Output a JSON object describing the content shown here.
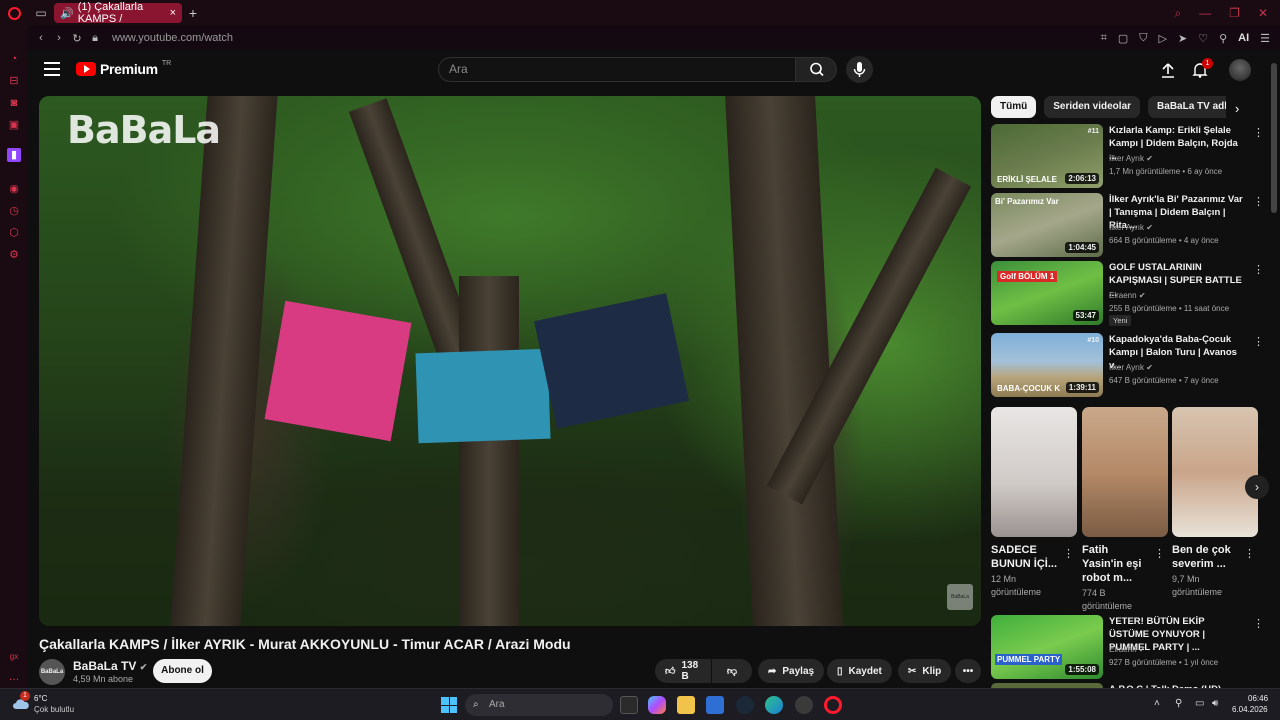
{
  "browser": {
    "tab_title": "(1) Çakallarla KAMPS /",
    "url": "www.youtube.com/watch",
    "ai_label": "AI"
  },
  "youtube": {
    "logo_text": "Premium",
    "country_code": "TR",
    "search_placeholder": "Ara",
    "notification_count": "1"
  },
  "player": {
    "brand_watermark": "BaBaLa",
    "corner_watermark": "BaBaLa"
  },
  "video": {
    "title": "Çakallarla KAMPS / İlker AYRIK - Murat AKKOYUNLU - Timur ACAR / Arazi Modu",
    "channel_name": "BaBaLa TV",
    "channel_avatar_text": "BaBaLa",
    "subscribers": "4,59 Mn abone",
    "subscribe_label": "Abone ol",
    "like_count": "138 B",
    "share_label": "Paylaş",
    "save_label": "Kaydet",
    "clip_label": "Klip"
  },
  "chips": [
    "Tümü",
    "Seriden videolar",
    "BaBaLa TV adlı yükle"
  ],
  "recommendations": [
    {
      "title": "Kızlarla Kamp: Erikli Şelale Kampı | Didem Balçın, Rojda ...",
      "channel": "İlker Ayrık",
      "views": "1,7 Mn görüntüleme",
      "age": "6 ay önce",
      "duration": "2:06:13",
      "thumb_text": "ERİKLİ ŞELALE",
      "episode": "#11"
    },
    {
      "title": "İlker Ayrık'la Bi' Pazarımız Var | Tanışma | Didem Balçın | Rita ...",
      "channel": "İlker Ayrık",
      "views": "664 B görüntüleme",
      "age": "4 ay önce",
      "duration": "1:04:45",
      "thumb_text": "Bi' Pazarımız Var"
    },
    {
      "title": "GOLF USTALARININ KAPIŞMASI | SUPER BATTLE ...",
      "channel": "Elraenn",
      "views": "255 B görüntüleme",
      "age": "11 saat önce",
      "duration": "53:47",
      "badge": "Yeni",
      "thumb_text": "Golf BÖLÜM 1"
    },
    {
      "title": "Kapadokya'da Baba-Çocuk Kampı | Balon Turu | Avanos v...",
      "channel": "İlker Ayrık",
      "views": "647 B görüntüleme",
      "age": "7 ay önce",
      "duration": "1:39:11",
      "thumb_text": "BABA-ÇOCUK K",
      "episode": "#10"
    }
  ],
  "shorts": [
    {
      "title": "SADECE BUNUN İÇİ...",
      "views": "12 Mn görüntüleme"
    },
    {
      "title": "Fatih Yasin'in eşi robot m...",
      "views": "774 B görüntüleme"
    },
    {
      "title": "Ben de çok severim ...",
      "views": "9,7 Mn görüntüleme"
    }
  ],
  "recommendation_5": {
    "title": "YETER! BÜTÜN EKİP ÜSTÜME OYNUYOR | PUMMEL PARTY | ...",
    "channel": "Elraenn",
    "views": "927 B görüntüleme",
    "age": "1 yıl önce",
    "duration": "1:55:08",
    "thumb_text": "PUMMEL PARTY"
  },
  "recommendation_6_partial_title": "A.P.O.C | Talk Demo (HD)",
  "taskbar": {
    "weather_temp": "6°C",
    "weather_desc": "Çok bulutlu",
    "weather_badge": "1",
    "search_placeholder": "Ara",
    "time": "06:46",
    "date": "6.04.2026"
  }
}
